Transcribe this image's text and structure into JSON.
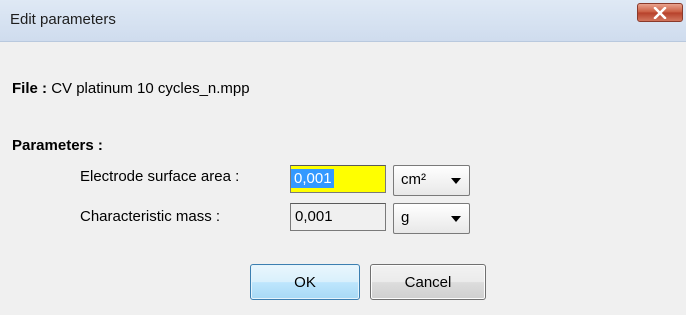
{
  "window": {
    "title": "Edit parameters"
  },
  "file": {
    "label": "File :",
    "value": "CV platinum 10 cycles_n.mpp"
  },
  "parameters": {
    "heading": "Parameters :",
    "electrode_area": {
      "label": "Electrode surface area :",
      "value": "0,001",
      "unit": "cm²",
      "highlight_color": "#ffff00",
      "selection_color": "#3399ff"
    },
    "characteristic_mass": {
      "label": "Characteristic mass :",
      "value": "0,001",
      "unit": "g"
    }
  },
  "buttons": {
    "ok": "OK",
    "cancel": "Cancel"
  },
  "icons": {
    "close": "close-icon",
    "dropdown": "chevron-down-icon"
  }
}
